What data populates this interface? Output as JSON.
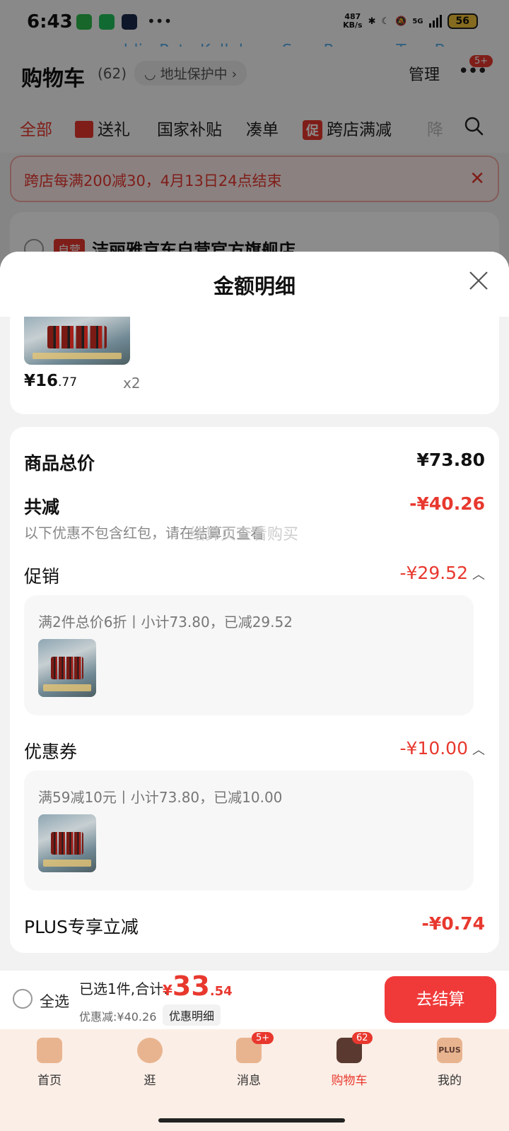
{
  "status_bar": {
    "time": "6:43",
    "net_speed_value": "487",
    "net_speed_unit": "KB/s",
    "network": "5G",
    "battery": "56"
  },
  "overlay_names": "ldi、Pete Kelleher、Sam Roman、Tom Barnes",
  "header": {
    "title": "购物车",
    "count": "(62)",
    "address": "地址保护中",
    "manage": "管理",
    "more_badge": "5+"
  },
  "tabs": [
    {
      "label": "全部"
    },
    {
      "label": "送礼"
    },
    {
      "label": "国家补贴"
    },
    {
      "label": "凑单"
    },
    {
      "label": "跨店满减",
      "tag": "促"
    },
    {
      "label": "降"
    }
  ],
  "promo_banner": {
    "text": "跨店每满200减30，4月13日24点结束"
  },
  "store": {
    "tag": "自营",
    "name": "洁丽雅京东自营官方旗舰店"
  },
  "sheet": {
    "title": "金额明细",
    "item": {
      "price_int": "¥16",
      "price_dec": ".77",
      "qty": "x2"
    },
    "total_label": "商品总价",
    "total_value": "¥73.80",
    "discount_label": "共减",
    "discount_value": "-¥40.26",
    "note": "以下优惠不包含红包，请在结算页查看",
    "note_overlap": "结算页查看购买",
    "promo": {
      "label": "促销",
      "value": "-¥29.52",
      "desc": "满2件总价6折丨小计73.80，已减29.52"
    },
    "coupon": {
      "label": "优惠券",
      "value": "-¥10.00",
      "desc": "满59减10元丨小计73.80，已减10.00"
    },
    "plus": {
      "label": "PLUS专享立减",
      "value": "-¥0.74"
    }
  },
  "checkout": {
    "select_all": "全选",
    "selected": "已选1件,合计:",
    "yen": "¥",
    "total_int": "33",
    "total_dec": ".54",
    "saved": "优惠减:¥40.26",
    "detail_btn": "优惠明细",
    "pay": "去结算"
  },
  "nav": [
    {
      "label": "首页"
    },
    {
      "label": "逛"
    },
    {
      "label": "消息",
      "badge": "5+"
    },
    {
      "label": "购物车",
      "badge": "62"
    },
    {
      "label": "我的",
      "icon_text": "PLUS"
    }
  ],
  "colors": {
    "accent": "#e8382e",
    "pay_button": "#f03a3a",
    "nav_bg": "#fbeee6"
  }
}
